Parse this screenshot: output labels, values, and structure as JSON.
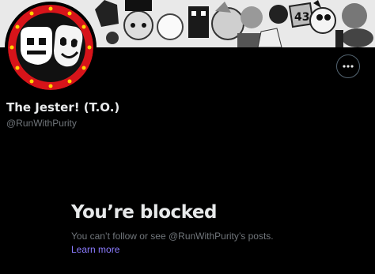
{
  "profile": {
    "display_name": "The Jester! (T.O.)",
    "handle": "@RunWithPurity",
    "banner_badge": "43"
  },
  "more_button": {
    "icon": "more-horizontal-icon"
  },
  "blocked": {
    "title": "You’re blocked",
    "message": "You can’t follow or see @RunWithPurity’s posts.",
    "learn_more": "Learn more"
  },
  "colors": {
    "background": "#000000",
    "primary_text": "#e7e9ea",
    "secondary_text": "#71767b",
    "link": "#8b7bff",
    "avatar_ring": "#e21b1b",
    "avatar_bulbs": "#ffd400"
  }
}
